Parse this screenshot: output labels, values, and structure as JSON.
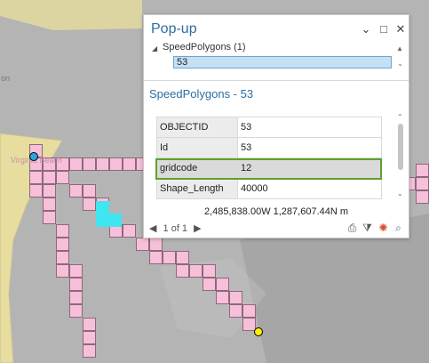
{
  "map": {
    "labels": {
      "left_edge": "on",
      "city": "Virginia Beach"
    },
    "colors": {
      "water": "#b4b4b4",
      "land": "#e6dd9e",
      "grid_cell": "#f7bfd9",
      "grid_selected": "#3fe5f0",
      "start_point": "#2aa7e0",
      "end_point": "#ffee00"
    }
  },
  "popup": {
    "title": "Pop-up",
    "header_icons": [
      "chevron-down-icon",
      "maximize-icon",
      "close-icon"
    ],
    "tree": {
      "layer": "SpeedPolygons (1)",
      "selected_feature": "53"
    },
    "detail_title": "SpeedPolygons - 53",
    "attributes": [
      {
        "field": "OBJECTID",
        "value": "53"
      },
      {
        "field": "Id",
        "value": "53"
      },
      {
        "field": "gridcode",
        "value": "12"
      },
      {
        "field": "Shape_Length",
        "value": "40000"
      }
    ],
    "coordinates": "2,485,838.00W 1,287,607.44N m",
    "pager": {
      "prev": "◀",
      "label": "1 of 1",
      "next": "▶"
    },
    "accent": "#2b6ea3",
    "highlight": "#5fa02d"
  }
}
